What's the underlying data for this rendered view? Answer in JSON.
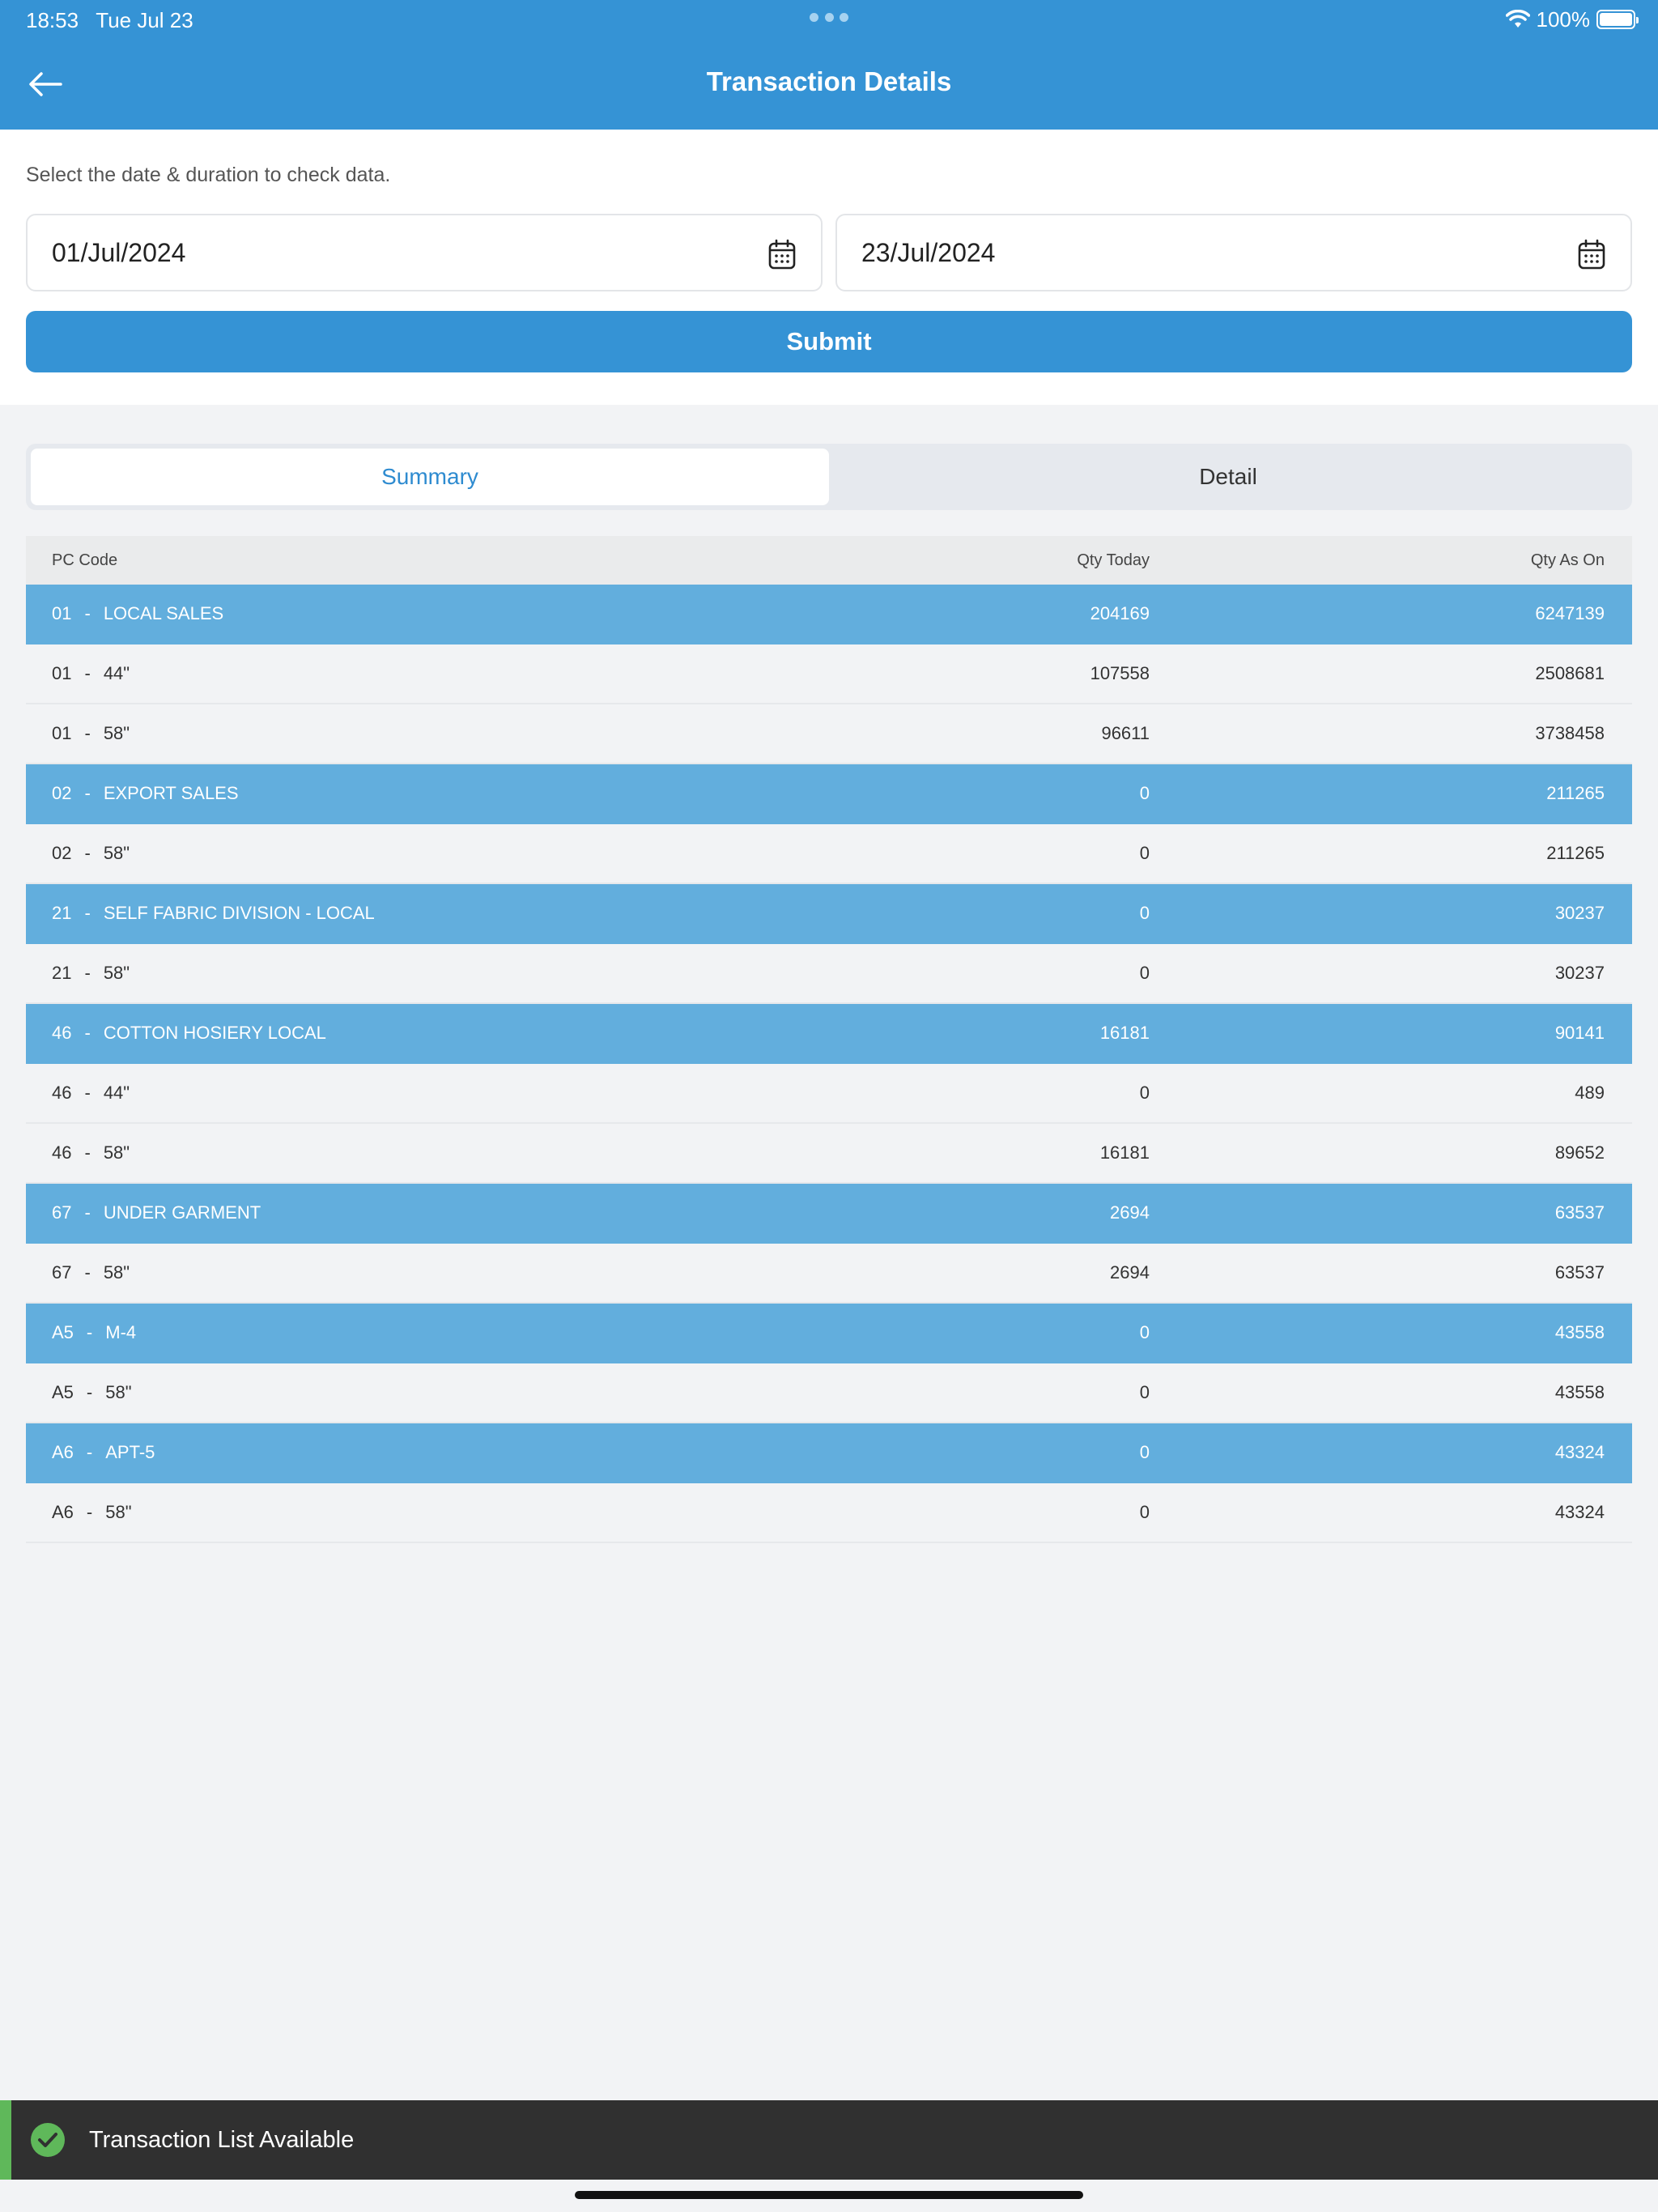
{
  "status_bar": {
    "time": "18:53",
    "date": "Tue Jul 23",
    "battery": "100%"
  },
  "nav": {
    "title": "Transaction Details",
    "back_icon": "arrow-left-icon"
  },
  "filter": {
    "hint": "Select the date & duration to check data.",
    "start_date": "01/Jul/2024",
    "end_date": "23/Jul/2024",
    "submit_label": "Submit"
  },
  "tabs": [
    {
      "label": "Summary",
      "active": true
    },
    {
      "label": "Detail",
      "active": false
    }
  ],
  "table": {
    "columns": [
      "PC Code",
      "Qty Today",
      "Qty As On"
    ],
    "separator": "-",
    "rows": [
      {
        "code": "01",
        "name": "LOCAL SALES",
        "qty_today": "204169",
        "qty_as_on": "6247139",
        "group": true
      },
      {
        "code": "01",
        "name": "44\"",
        "qty_today": "107558",
        "qty_as_on": "2508681",
        "group": false
      },
      {
        "code": "01",
        "name": "58\"",
        "qty_today": "96611",
        "qty_as_on": "3738458",
        "group": false
      },
      {
        "code": "02",
        "name": "EXPORT SALES",
        "qty_today": "0",
        "qty_as_on": "211265",
        "group": true
      },
      {
        "code": "02",
        "name": "58\"",
        "qty_today": "0",
        "qty_as_on": "211265",
        "group": false
      },
      {
        "code": "21",
        "name": "SELF FABRIC DIVISION - LOCAL",
        "qty_today": "0",
        "qty_as_on": "30237",
        "group": true
      },
      {
        "code": "21",
        "name": "58\"",
        "qty_today": "0",
        "qty_as_on": "30237",
        "group": false
      },
      {
        "code": "46",
        "name": "COTTON HOSIERY LOCAL",
        "qty_today": "16181",
        "qty_as_on": "90141",
        "group": true
      },
      {
        "code": "46",
        "name": "44\"",
        "qty_today": "0",
        "qty_as_on": "489",
        "group": false
      },
      {
        "code": "46",
        "name": "58\"",
        "qty_today": "16181",
        "qty_as_on": "89652",
        "group": false
      },
      {
        "code": "67",
        "name": "UNDER GARMENT",
        "qty_today": "2694",
        "qty_as_on": "63537",
        "group": true
      },
      {
        "code": "67",
        "name": "58\"",
        "qty_today": "2694",
        "qty_as_on": "63537",
        "group": false
      },
      {
        "code": "A5",
        "name": "M-4",
        "qty_today": "0",
        "qty_as_on": "43558",
        "group": true
      },
      {
        "code": "A5",
        "name": "58\"",
        "qty_today": "0",
        "qty_as_on": "43558",
        "group": false
      },
      {
        "code": "A6",
        "name": "APT-5",
        "qty_today": "0",
        "qty_as_on": "43324",
        "group": true
      },
      {
        "code": "A6",
        "name": "58\"",
        "qty_today": "0",
        "qty_as_on": "43324",
        "group": false
      }
    ]
  },
  "snackbar": {
    "message": "Transaction List Available",
    "icon": "check-circle-icon"
  },
  "colors": {
    "primary": "#3593d5",
    "group_row": "#62aedd",
    "success": "#5fb85a",
    "snackbar_bg": "#303030"
  }
}
